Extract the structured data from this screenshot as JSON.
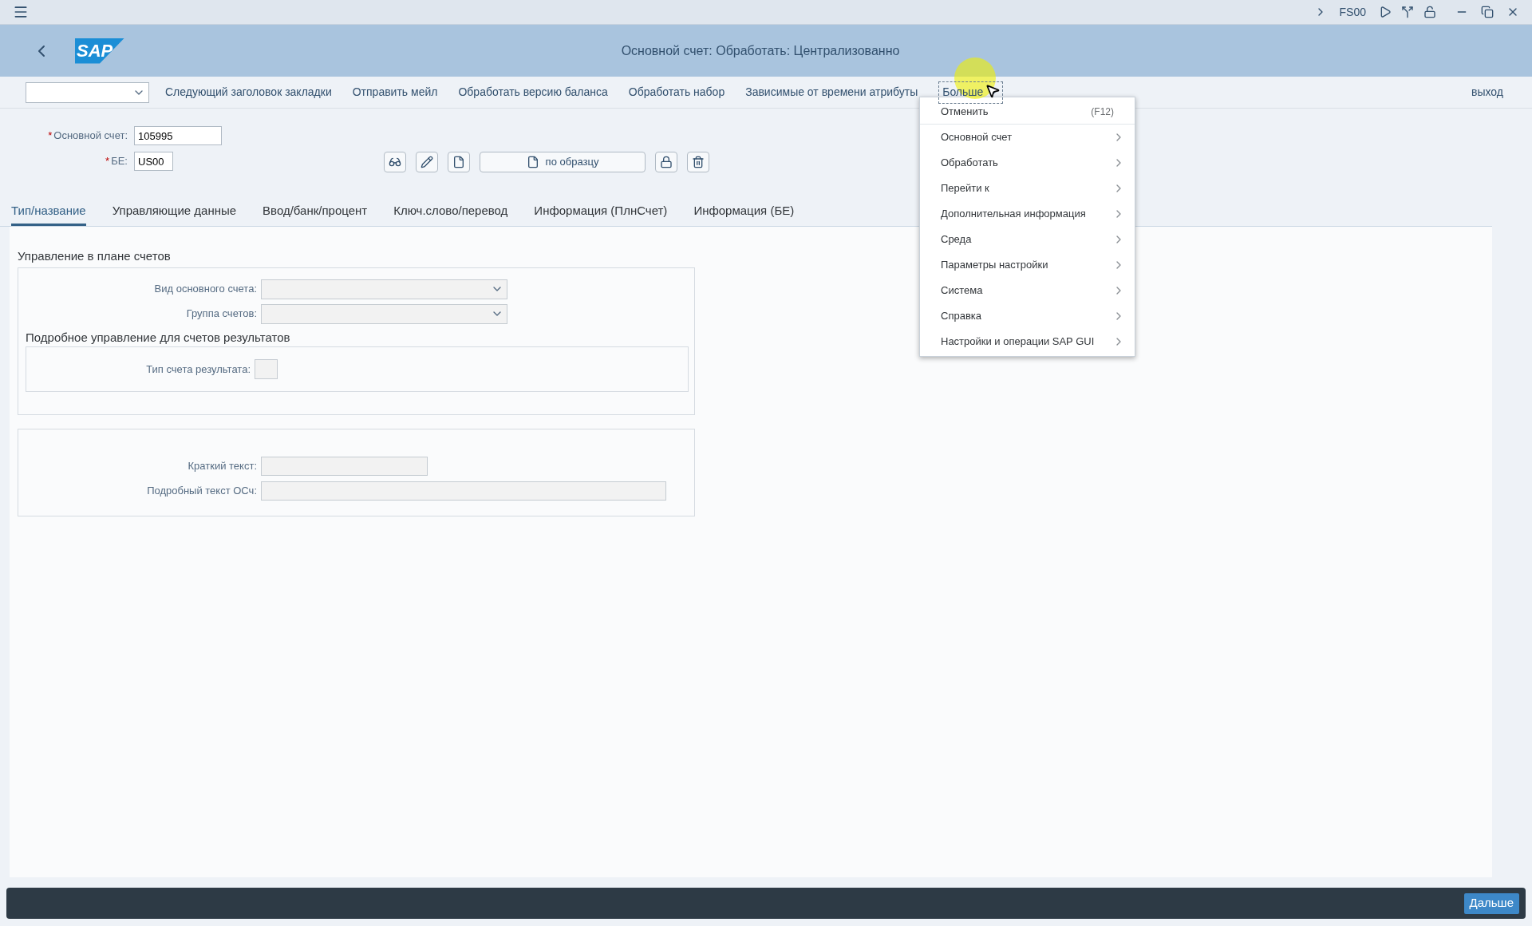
{
  "top_bar": {
    "transaction": "FS00"
  },
  "header": {
    "logo": "SAP",
    "title": "Основной счет: Обработать: Централизованно"
  },
  "toolbar": {
    "items": [
      "Следующий заголовок закладки",
      "Отправить мейл",
      "Обработать версию баланса",
      "Обработать набор",
      "Зависимые от времени атрибуты"
    ],
    "more": "Больше",
    "exit": "выход"
  },
  "fields": [
    {
      "label": "Основной счет:",
      "value": "105995",
      "required_mark": "*"
    },
    {
      "label": "БЕ:",
      "value": "US00",
      "required_mark": "*"
    }
  ],
  "copy_button": "по образцу",
  "tabs": [
    {
      "label": "Тип/название",
      "selected": true
    },
    {
      "label": "Управляющие данные",
      "selected": false
    },
    {
      "label": "Ввод/банк/процент",
      "selected": false
    },
    {
      "label": "Ключ.слово/перевод",
      "selected": false
    },
    {
      "label": "Информация (ПлнСчет)",
      "selected": false
    },
    {
      "label": "Информация (БЕ)",
      "selected": false
    }
  ],
  "group1": {
    "title": "Управление в плане счетов",
    "dropdowns": [
      "Вид основного счета:",
      "Группа счетов:"
    ],
    "subgroup": {
      "title": "Подробное управление для счетов результатов",
      "field": "Тип счета результата:"
    }
  },
  "group2": {
    "fields": [
      "Краткий текст:",
      "Подробный текст ОСч:"
    ]
  },
  "menu": {
    "items": [
      {
        "label": "Отменить",
        "shortcut": "(F12)",
        "kind": "action"
      },
      {
        "label": "Основной счет",
        "kind": "submenu"
      },
      {
        "label": "Обработать",
        "kind": "submenu"
      },
      {
        "label": "Перейти к",
        "kind": "submenu"
      },
      {
        "label": "Дополнительная информация",
        "kind": "submenu"
      },
      {
        "label": "Среда",
        "kind": "submenu"
      },
      {
        "label": "Параметры настройки",
        "kind": "submenu"
      },
      {
        "label": "Система",
        "kind": "submenu"
      },
      {
        "label": "Справка",
        "kind": "submenu"
      },
      {
        "label": "Настройки и операции SAP GUI",
        "kind": "submenu"
      }
    ]
  },
  "footer": {
    "button": "Дальше"
  }
}
